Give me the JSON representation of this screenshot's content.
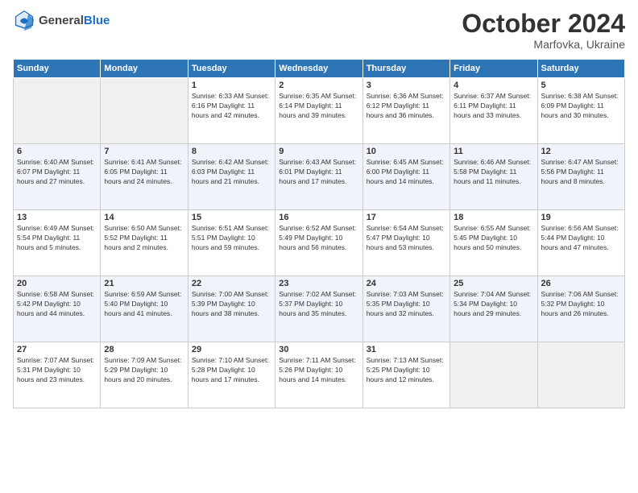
{
  "header": {
    "logo_general": "General",
    "logo_blue": "Blue",
    "month": "October 2024",
    "location": "Marfovka, Ukraine"
  },
  "days_of_week": [
    "Sunday",
    "Monday",
    "Tuesday",
    "Wednesday",
    "Thursday",
    "Friday",
    "Saturday"
  ],
  "weeks": [
    [
      {
        "day": "",
        "info": ""
      },
      {
        "day": "",
        "info": ""
      },
      {
        "day": "1",
        "info": "Sunrise: 6:33 AM\nSunset: 6:16 PM\nDaylight: 11 hours and 42 minutes."
      },
      {
        "day": "2",
        "info": "Sunrise: 6:35 AM\nSunset: 6:14 PM\nDaylight: 11 hours and 39 minutes."
      },
      {
        "day": "3",
        "info": "Sunrise: 6:36 AM\nSunset: 6:12 PM\nDaylight: 11 hours and 36 minutes."
      },
      {
        "day": "4",
        "info": "Sunrise: 6:37 AM\nSunset: 6:11 PM\nDaylight: 11 hours and 33 minutes."
      },
      {
        "day": "5",
        "info": "Sunrise: 6:38 AM\nSunset: 6:09 PM\nDaylight: 11 hours and 30 minutes."
      }
    ],
    [
      {
        "day": "6",
        "info": "Sunrise: 6:40 AM\nSunset: 6:07 PM\nDaylight: 11 hours and 27 minutes."
      },
      {
        "day": "7",
        "info": "Sunrise: 6:41 AM\nSunset: 6:05 PM\nDaylight: 11 hours and 24 minutes."
      },
      {
        "day": "8",
        "info": "Sunrise: 6:42 AM\nSunset: 6:03 PM\nDaylight: 11 hours and 21 minutes."
      },
      {
        "day": "9",
        "info": "Sunrise: 6:43 AM\nSunset: 6:01 PM\nDaylight: 11 hours and 17 minutes."
      },
      {
        "day": "10",
        "info": "Sunrise: 6:45 AM\nSunset: 6:00 PM\nDaylight: 11 hours and 14 minutes."
      },
      {
        "day": "11",
        "info": "Sunrise: 6:46 AM\nSunset: 5:58 PM\nDaylight: 11 hours and 11 minutes."
      },
      {
        "day": "12",
        "info": "Sunrise: 6:47 AM\nSunset: 5:56 PM\nDaylight: 11 hours and 8 minutes."
      }
    ],
    [
      {
        "day": "13",
        "info": "Sunrise: 6:49 AM\nSunset: 5:54 PM\nDaylight: 11 hours and 5 minutes."
      },
      {
        "day": "14",
        "info": "Sunrise: 6:50 AM\nSunset: 5:52 PM\nDaylight: 11 hours and 2 minutes."
      },
      {
        "day": "15",
        "info": "Sunrise: 6:51 AM\nSunset: 5:51 PM\nDaylight: 10 hours and 59 minutes."
      },
      {
        "day": "16",
        "info": "Sunrise: 6:52 AM\nSunset: 5:49 PM\nDaylight: 10 hours and 56 minutes."
      },
      {
        "day": "17",
        "info": "Sunrise: 6:54 AM\nSunset: 5:47 PM\nDaylight: 10 hours and 53 minutes."
      },
      {
        "day": "18",
        "info": "Sunrise: 6:55 AM\nSunset: 5:45 PM\nDaylight: 10 hours and 50 minutes."
      },
      {
        "day": "19",
        "info": "Sunrise: 6:56 AM\nSunset: 5:44 PM\nDaylight: 10 hours and 47 minutes."
      }
    ],
    [
      {
        "day": "20",
        "info": "Sunrise: 6:58 AM\nSunset: 5:42 PM\nDaylight: 10 hours and 44 minutes."
      },
      {
        "day": "21",
        "info": "Sunrise: 6:59 AM\nSunset: 5:40 PM\nDaylight: 10 hours and 41 minutes."
      },
      {
        "day": "22",
        "info": "Sunrise: 7:00 AM\nSunset: 5:39 PM\nDaylight: 10 hours and 38 minutes."
      },
      {
        "day": "23",
        "info": "Sunrise: 7:02 AM\nSunset: 5:37 PM\nDaylight: 10 hours and 35 minutes."
      },
      {
        "day": "24",
        "info": "Sunrise: 7:03 AM\nSunset: 5:35 PM\nDaylight: 10 hours and 32 minutes."
      },
      {
        "day": "25",
        "info": "Sunrise: 7:04 AM\nSunset: 5:34 PM\nDaylight: 10 hours and 29 minutes."
      },
      {
        "day": "26",
        "info": "Sunrise: 7:06 AM\nSunset: 5:32 PM\nDaylight: 10 hours and 26 minutes."
      }
    ],
    [
      {
        "day": "27",
        "info": "Sunrise: 7:07 AM\nSunset: 5:31 PM\nDaylight: 10 hours and 23 minutes."
      },
      {
        "day": "28",
        "info": "Sunrise: 7:09 AM\nSunset: 5:29 PM\nDaylight: 10 hours and 20 minutes."
      },
      {
        "day": "29",
        "info": "Sunrise: 7:10 AM\nSunset: 5:28 PM\nDaylight: 10 hours and 17 minutes."
      },
      {
        "day": "30",
        "info": "Sunrise: 7:11 AM\nSunset: 5:26 PM\nDaylight: 10 hours and 14 minutes."
      },
      {
        "day": "31",
        "info": "Sunrise: 7:13 AM\nSunset: 5:25 PM\nDaylight: 10 hours and 12 minutes."
      },
      {
        "day": "",
        "info": ""
      },
      {
        "day": "",
        "info": ""
      }
    ]
  ]
}
